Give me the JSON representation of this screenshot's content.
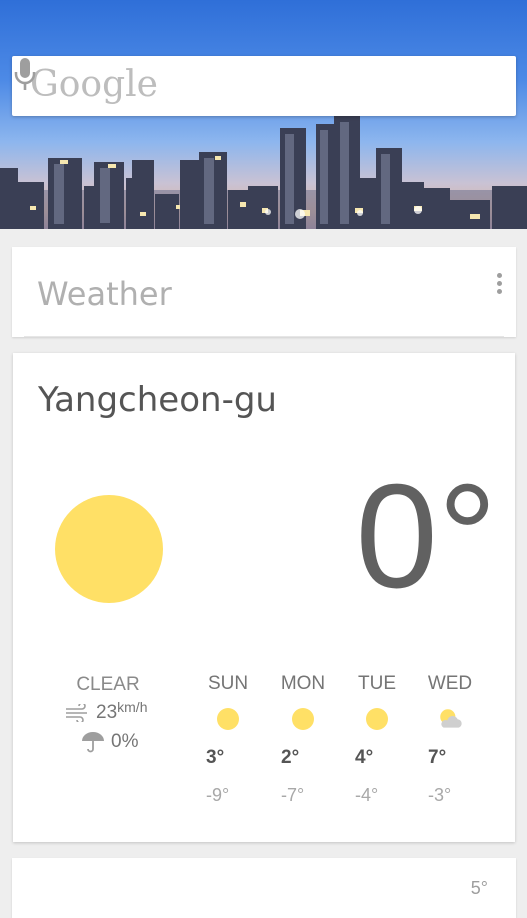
{
  "search": {
    "logo_text": "Google",
    "mic_icon": "microphone-icon"
  },
  "weather_card_title": {
    "title": "Weather",
    "menu_icon": "more-vertical-icon"
  },
  "weather": {
    "location": "Yangcheon-gu",
    "current_temp": "0°",
    "current_icon": "sun-icon",
    "condition": "CLEAR",
    "wind": "23",
    "wind_unit": "km/h",
    "precipitation": "0%",
    "forecast": [
      {
        "day": "SUN",
        "icon": "sun-icon",
        "high": "3°",
        "low": "-9°"
      },
      {
        "day": "MON",
        "icon": "sun-icon",
        "high": "2°",
        "low": "-7°"
      },
      {
        "day": "TUE",
        "icon": "sun-icon",
        "high": "4°",
        "low": "-4°"
      },
      {
        "day": "WED",
        "icon": "partly-cloudy-icon",
        "high": "7°",
        "low": "-3°"
      }
    ]
  },
  "next_card": {
    "partial_text": "5°"
  },
  "colors": {
    "sun": "#ffe066",
    "accent_blue": "#2f6fd8"
  }
}
